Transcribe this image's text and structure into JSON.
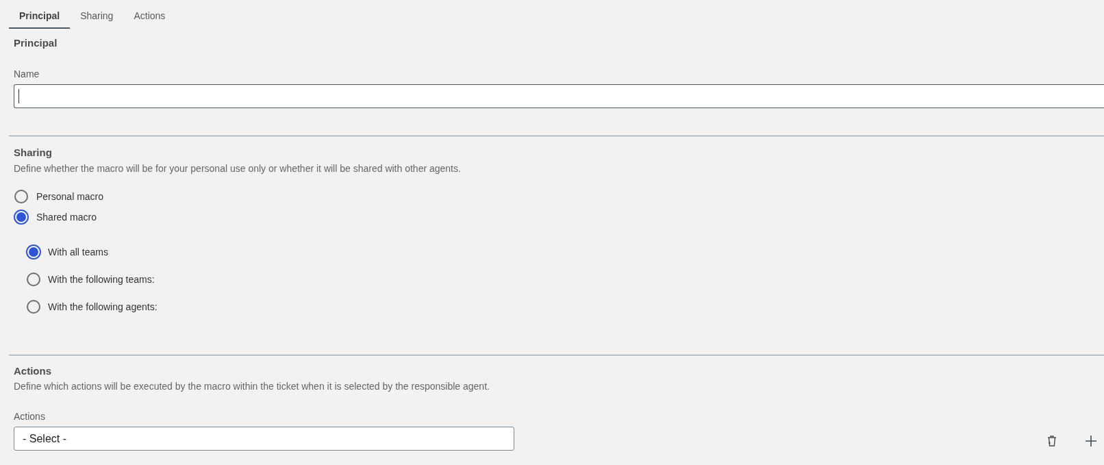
{
  "tabs": [
    {
      "label": "Principal",
      "selected": true
    },
    {
      "label": "Sharing",
      "selected": false
    },
    {
      "label": "Actions",
      "selected": false
    }
  ],
  "principal": {
    "title": "Principal",
    "name_field": {
      "label": "Name",
      "focused": true
    }
  },
  "sharing": {
    "title": "Sharing",
    "description": "Define whether the macro will be for your personal use only or whether it will be shared with other agents.",
    "options": [
      {
        "label": "Personal macro",
        "selected": false
      },
      {
        "label": "Shared macro",
        "selected": true,
        "children": [
          {
            "label": "With all teams",
            "selected": true
          },
          {
            "label": "With the following teams:",
            "selected": false
          },
          {
            "label": "With the following agents:",
            "selected": false
          }
        ]
      }
    ]
  },
  "actions": {
    "title": "Actions",
    "description": "Define which actions will be executed by the macro within the ticket when it is selected by the responsible agent.",
    "field": {
      "label": "Actions",
      "value": "- Select -"
    }
  }
}
